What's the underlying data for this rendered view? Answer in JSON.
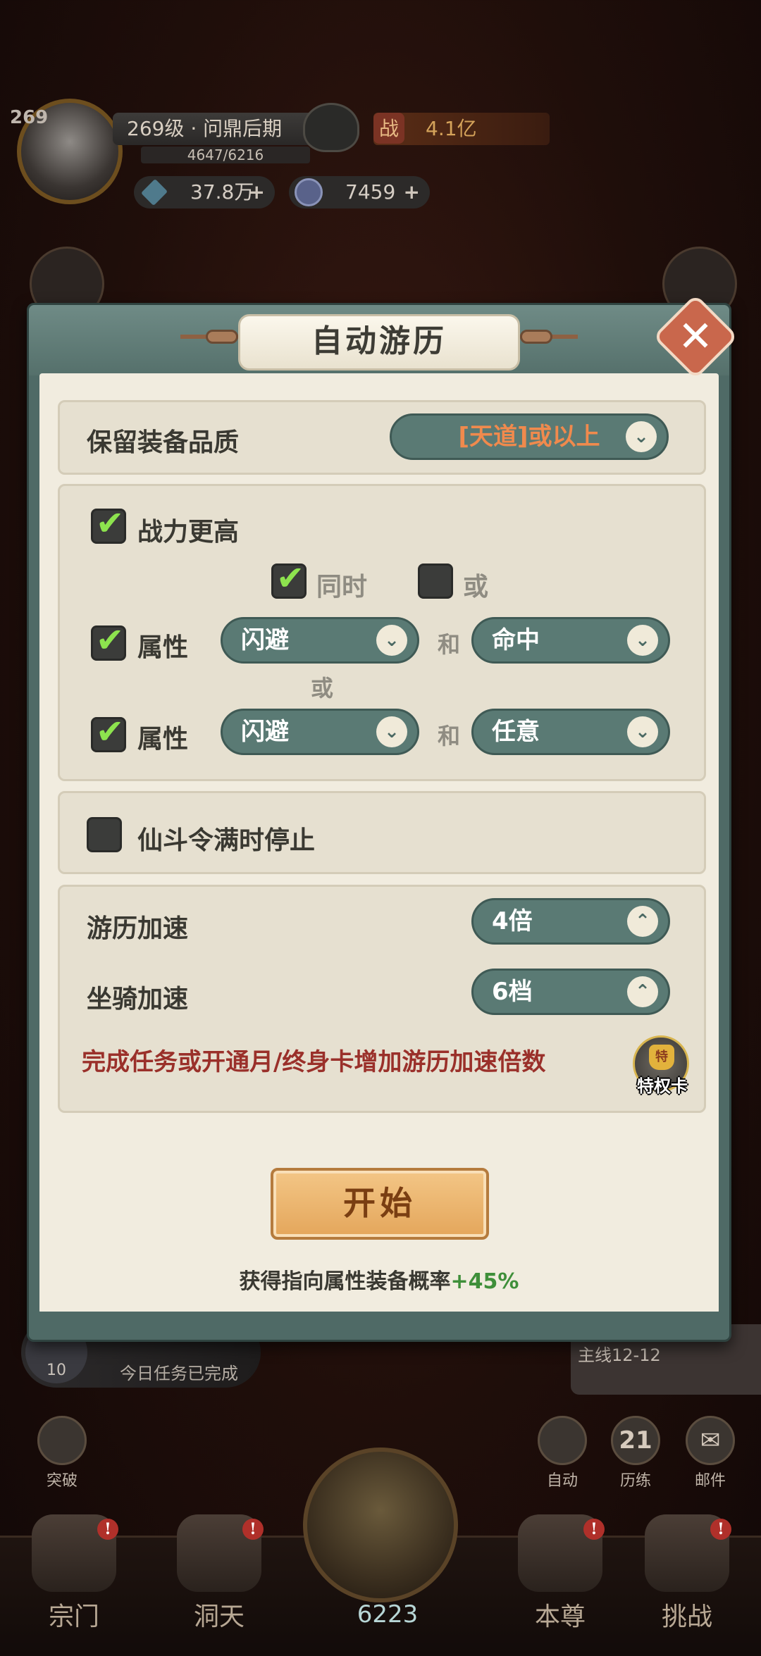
{
  "hud": {
    "level_badge": "269",
    "level_text": "269级 · 问鼎后期",
    "exp_text": "4647/6216",
    "power_label": "战",
    "power_value": "4.1亿",
    "currency1_value": "37.8万",
    "currency2_value": "7459",
    "plus": "+"
  },
  "background": {
    "quest_count": "10",
    "quest_text": "今日任务已完成",
    "stage_text": "主线12-12",
    "side_buttons": [
      {
        "label": "突破",
        "glyph": ""
      },
      {
        "label": "自动",
        "glyph": ""
      },
      {
        "label": "历练",
        "glyph": "21"
      },
      {
        "label": "邮件",
        "glyph": "✉"
      }
    ],
    "nav": [
      {
        "label": "宗门"
      },
      {
        "label": "洞天"
      },
      {
        "label": "本尊"
      },
      {
        "label": "挑战"
      }
    ],
    "badge": "!",
    "center_count": "6223"
  },
  "modal": {
    "title": "自动游历",
    "close_glyph": "✕",
    "quality_label": "保留装备品质",
    "quality_value": "[天道]或以上",
    "power_higher_label": "战力更高",
    "same_time_label": "同时",
    "or_label": "或",
    "attr_label": "属性",
    "and_label": "和",
    "row1_attr1": "闪避",
    "row1_attr2": "命中",
    "row2_attr1": "闪避",
    "row2_attr2": "任意",
    "stop_label": "仙斗令满时停止",
    "speed_label": "游历加速",
    "speed_value": "4倍",
    "mount_label": "坐骑加速",
    "mount_value": "6档",
    "note": "完成任务或开通月/终身卡增加游历加速倍数",
    "privilege_label": "特权卡",
    "privilege_crown": "特",
    "start_label": "开始",
    "prob_text": "获得指向属性装备概率",
    "prob_value": "+45%",
    "check_glyph": "✔",
    "chev_down": "⌄",
    "chev_up": "⌃"
  },
  "checks": {
    "power_higher": true,
    "same_time": true,
    "or": false,
    "row1": true,
    "row2": true,
    "stop_full": false
  },
  "colors": {
    "modal_teal": "#5a7a74",
    "panel_bg": "#e6e0d0",
    "check_green": "#8de34e",
    "note_red": "#9a302a",
    "accent_orange": "#f08a4d",
    "prob_green": "#3f8f3a"
  }
}
